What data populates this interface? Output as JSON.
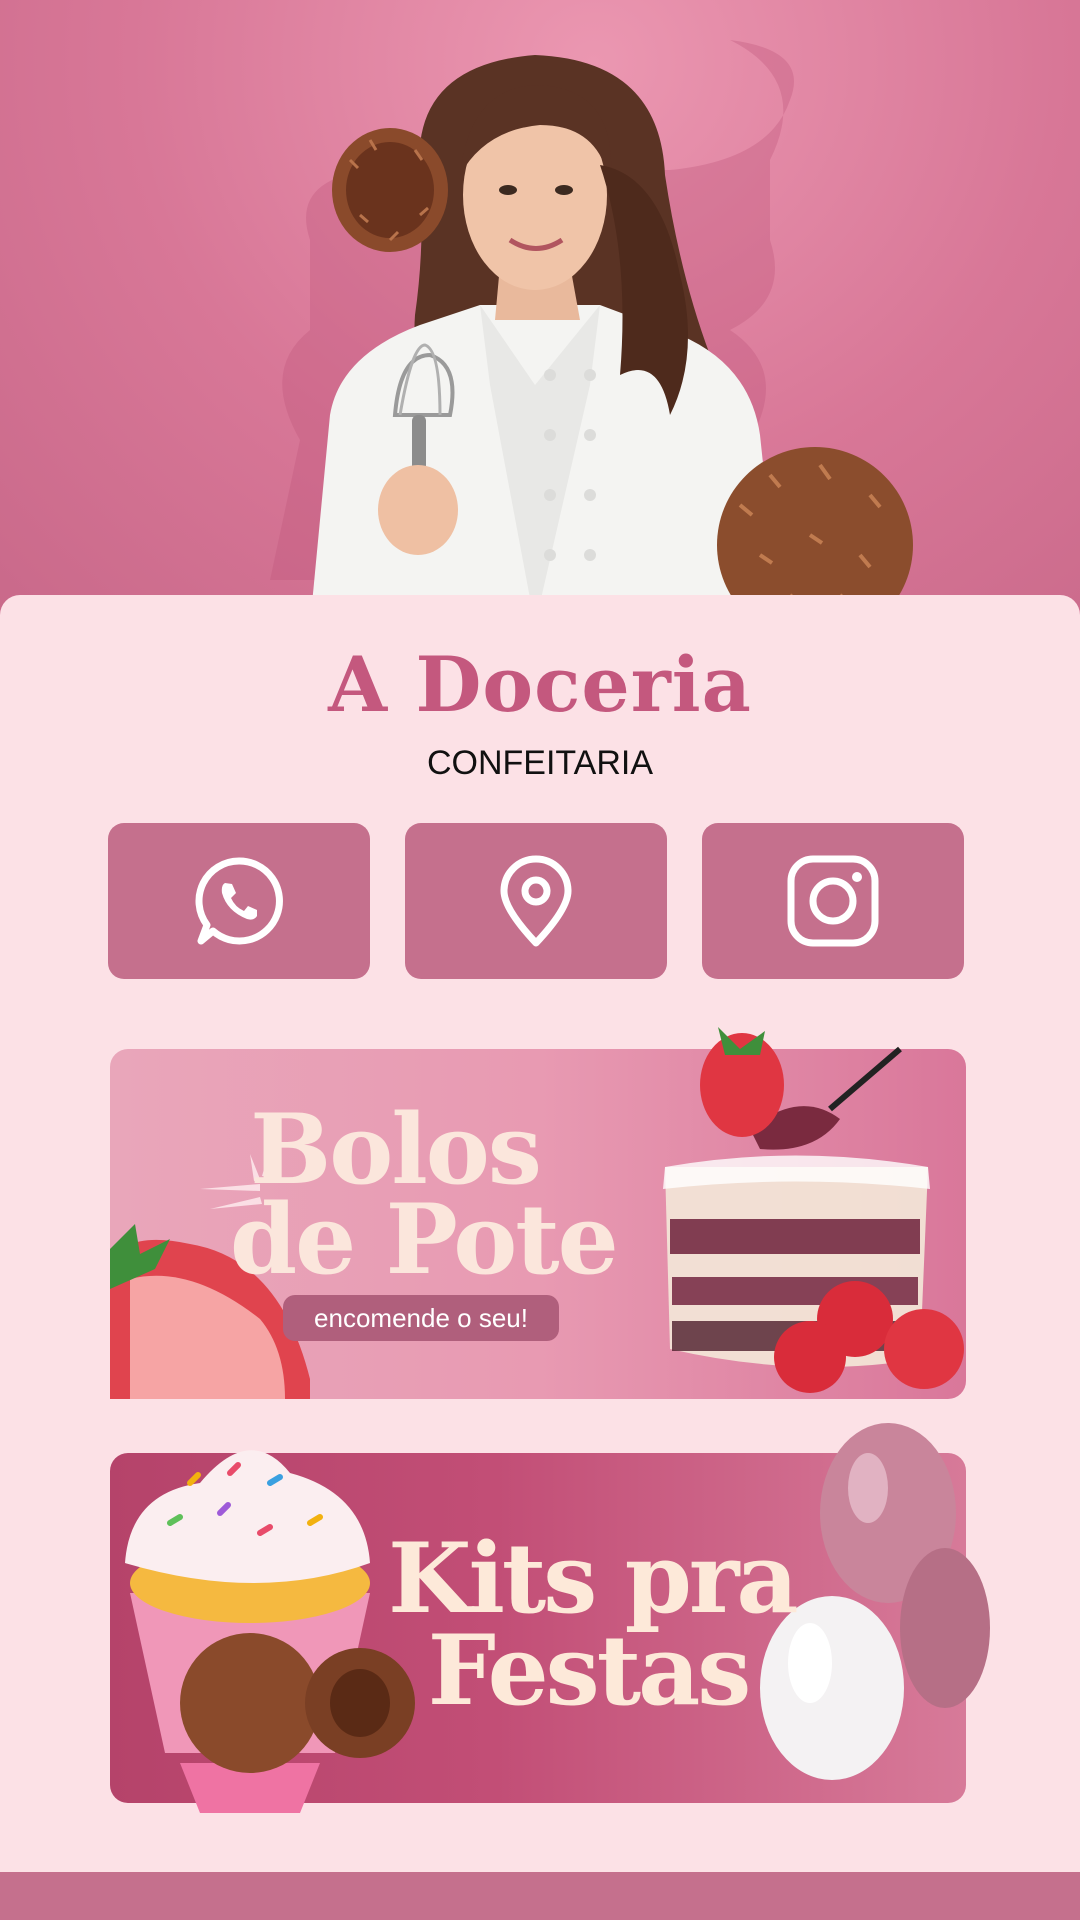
{
  "brand": {
    "title": "A Doceria",
    "subtitle": "CONFEITARIA"
  },
  "contact_buttons": [
    {
      "icon": "whatsapp-icon"
    },
    {
      "icon": "location-pin-icon"
    },
    {
      "icon": "instagram-icon"
    }
  ],
  "banners": {
    "bolos": {
      "title_line1": "Bolos",
      "title_line2": "de Pote",
      "cta": "encomende o seu!"
    },
    "kits": {
      "title_line1": "Kits pra",
      "title_line2": "Festas"
    }
  },
  "colors": {
    "accent": "#c5708d",
    "brand_title": "#c4587e",
    "background": "#fce1e6",
    "hero": "#d87797"
  }
}
